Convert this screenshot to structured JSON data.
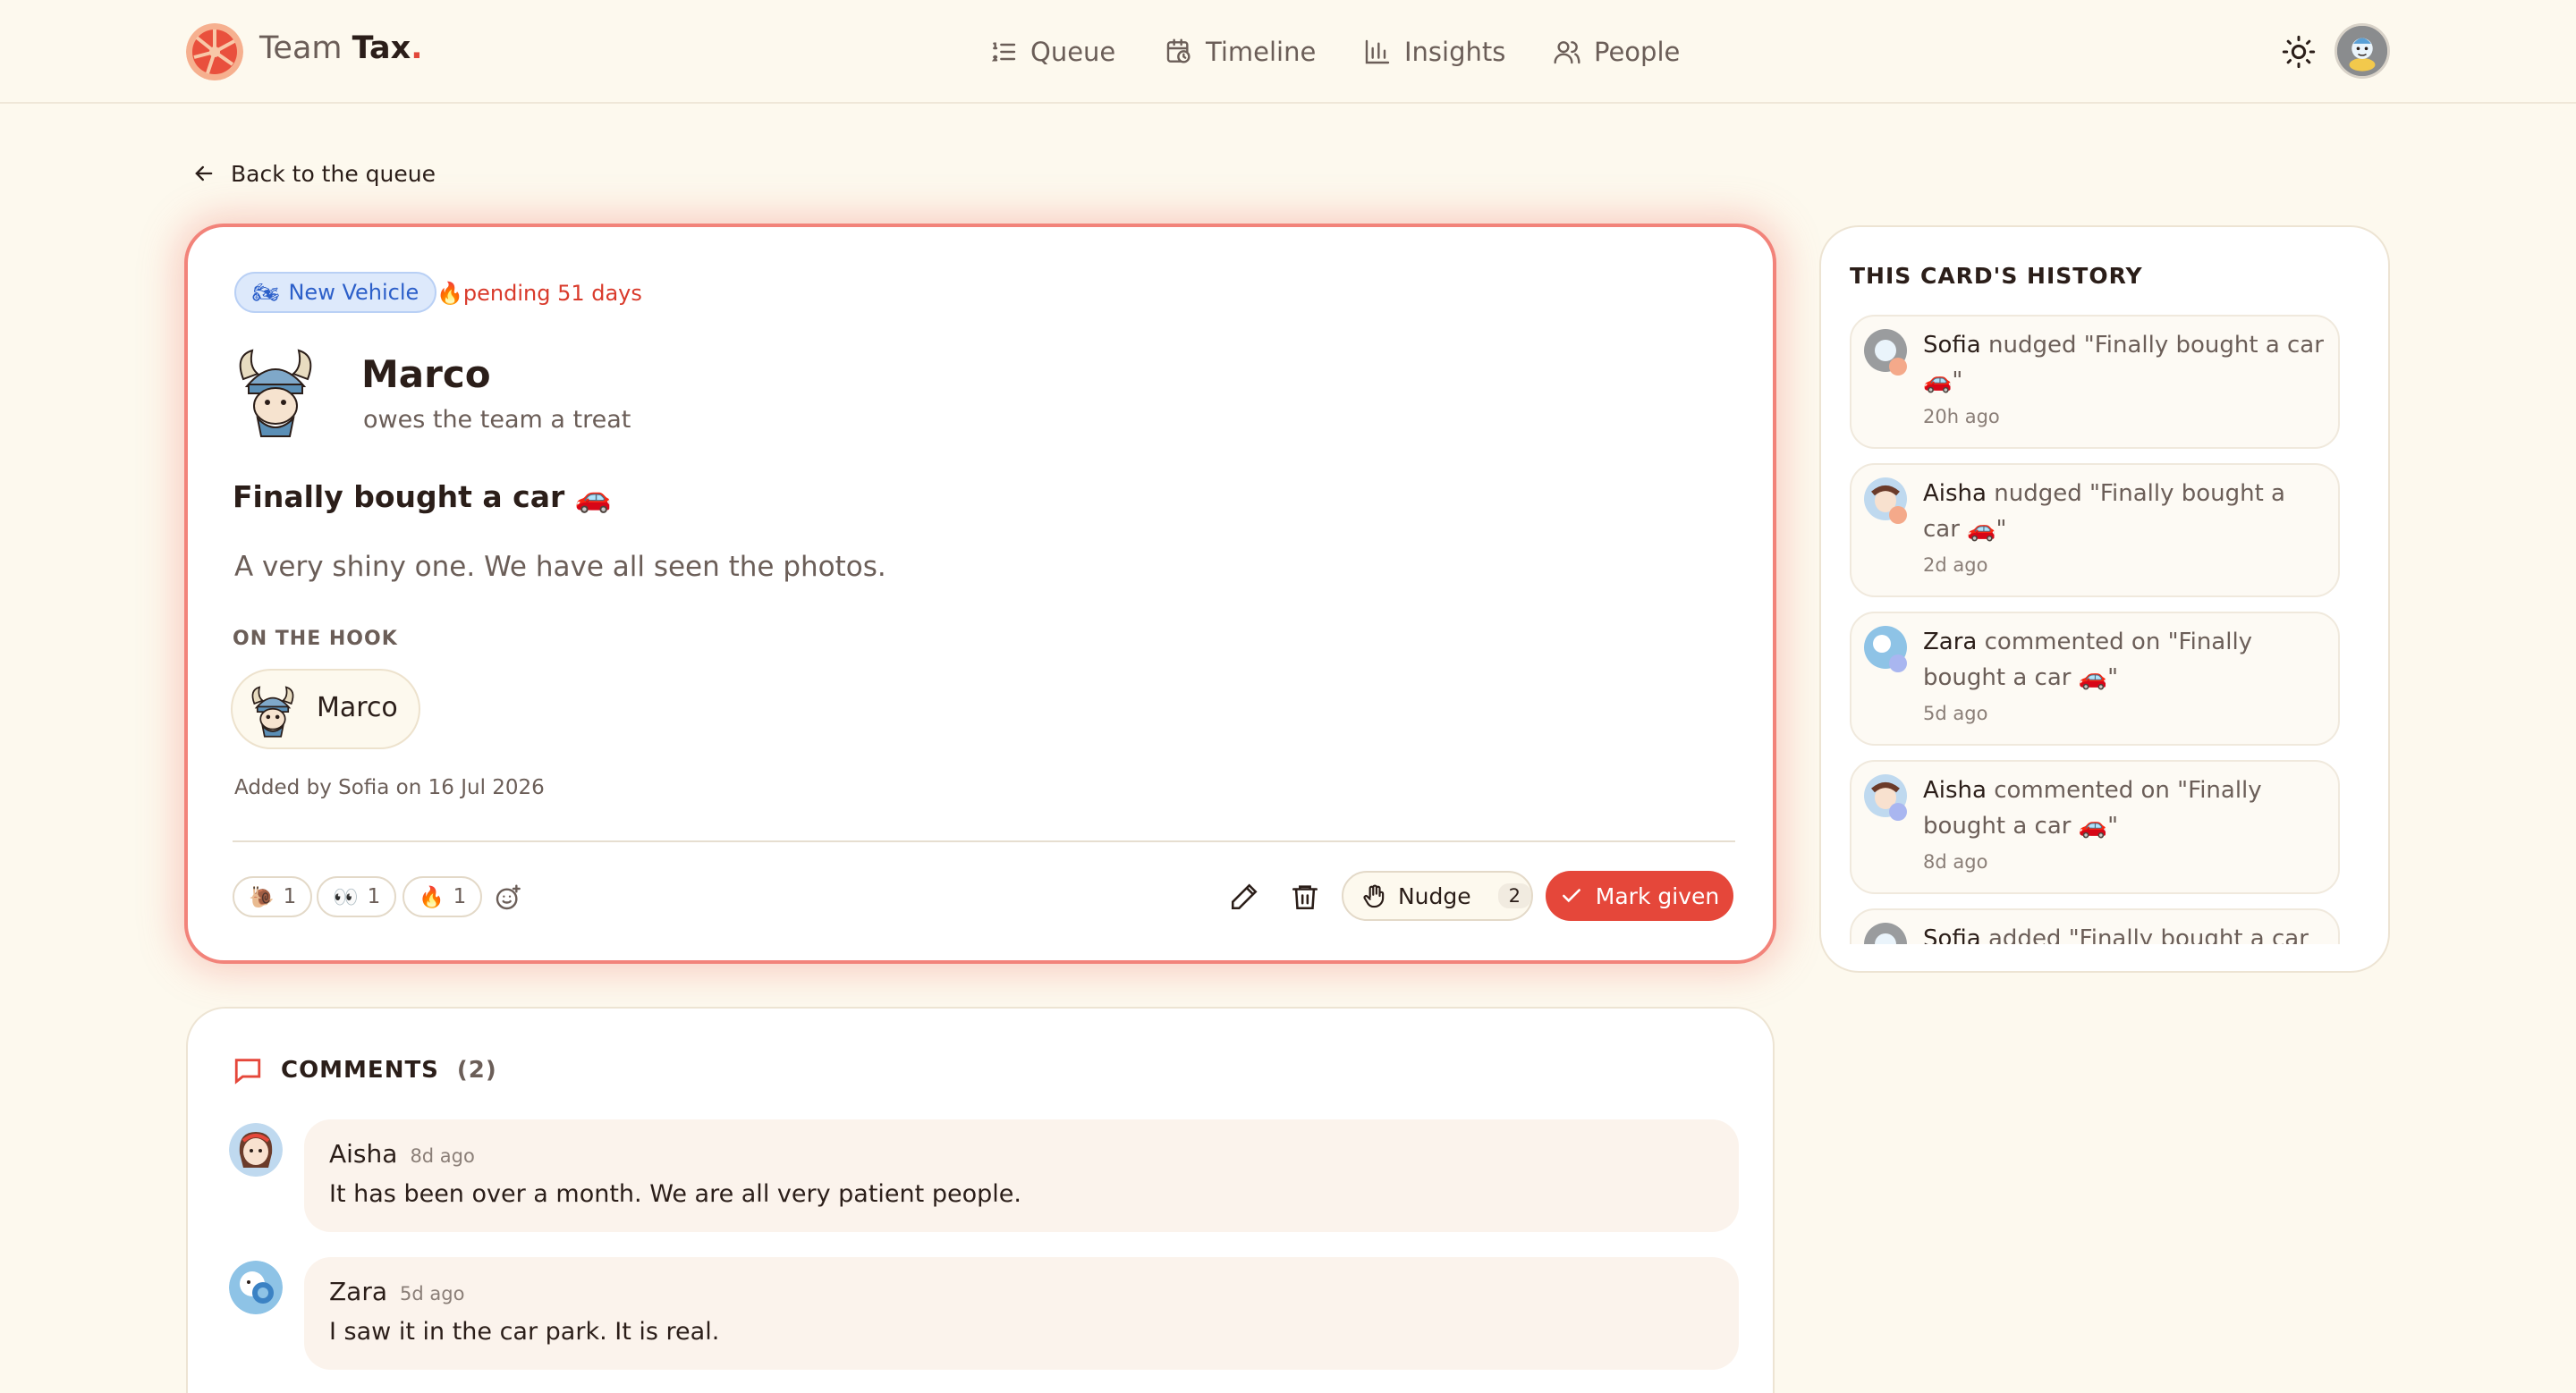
{
  "header": {
    "brand_prefix": "Team ",
    "brand_strong": "Tax",
    "brand_dot": ".",
    "nav": [
      {
        "label": "Queue",
        "icon": "list-ordered-icon"
      },
      {
        "label": "Timeline",
        "icon": "calendar-clock-icon"
      },
      {
        "label": "Insights",
        "icon": "bar-chart-icon"
      },
      {
        "label": "People",
        "icon": "users-icon"
      }
    ],
    "theme_icon": "sun-icon"
  },
  "back_link": "Back to the queue",
  "card": {
    "category": "New Vehicle",
    "category_icon": "🏍",
    "pending": "🔥pending 51 days",
    "person_name": "Marco",
    "person_sub": "owes the team a treat",
    "title": "Finally bought a car 🚗",
    "description": "A very shiny one. We have all seen the photos.",
    "hook_label": "ON THE HOOK",
    "hook_person": "Marco",
    "added": "Added by Sofia on 16 Jul 2026",
    "reactions": [
      {
        "emoji": "🐌",
        "count": "1"
      },
      {
        "emoji": "👀",
        "count": "1"
      },
      {
        "emoji": "🔥",
        "count": "1"
      }
    ],
    "nudge_label": "Nudge",
    "nudge_count": "2",
    "mark_label": "Mark given"
  },
  "comments": {
    "heading": "COMMENTS",
    "count": "(2)",
    "items": [
      {
        "author": "Aisha",
        "when": "8d ago",
        "text": "It has been over a month. We are all very patient people."
      },
      {
        "author": "Zara",
        "when": "5d ago",
        "text": "I saw it in the car park. It is real."
      }
    ]
  },
  "history": {
    "title": "THIS CARD'S HISTORY",
    "items": [
      {
        "who": "Sofia",
        "action": " nudged \"Finally bought a car 🚗\"",
        "ago": "20h ago"
      },
      {
        "who": "Aisha",
        "action": " nudged \"Finally bought a car 🚗\"",
        "ago": "2d ago"
      },
      {
        "who": "Zara",
        "action": " commented on \"Finally bought a car 🚗\"",
        "ago": "5d ago"
      },
      {
        "who": "Aisha",
        "action": " commented on \"Finally bought a car 🚗\"",
        "ago": "8d ago"
      },
      {
        "who": "Sofia",
        "action": " added \"Finally bought a car",
        "ago": ""
      }
    ]
  },
  "colors": {
    "accent": "#e5473a",
    "background": "#fdf9ee",
    "tag_blue": "#2c5fc9"
  }
}
